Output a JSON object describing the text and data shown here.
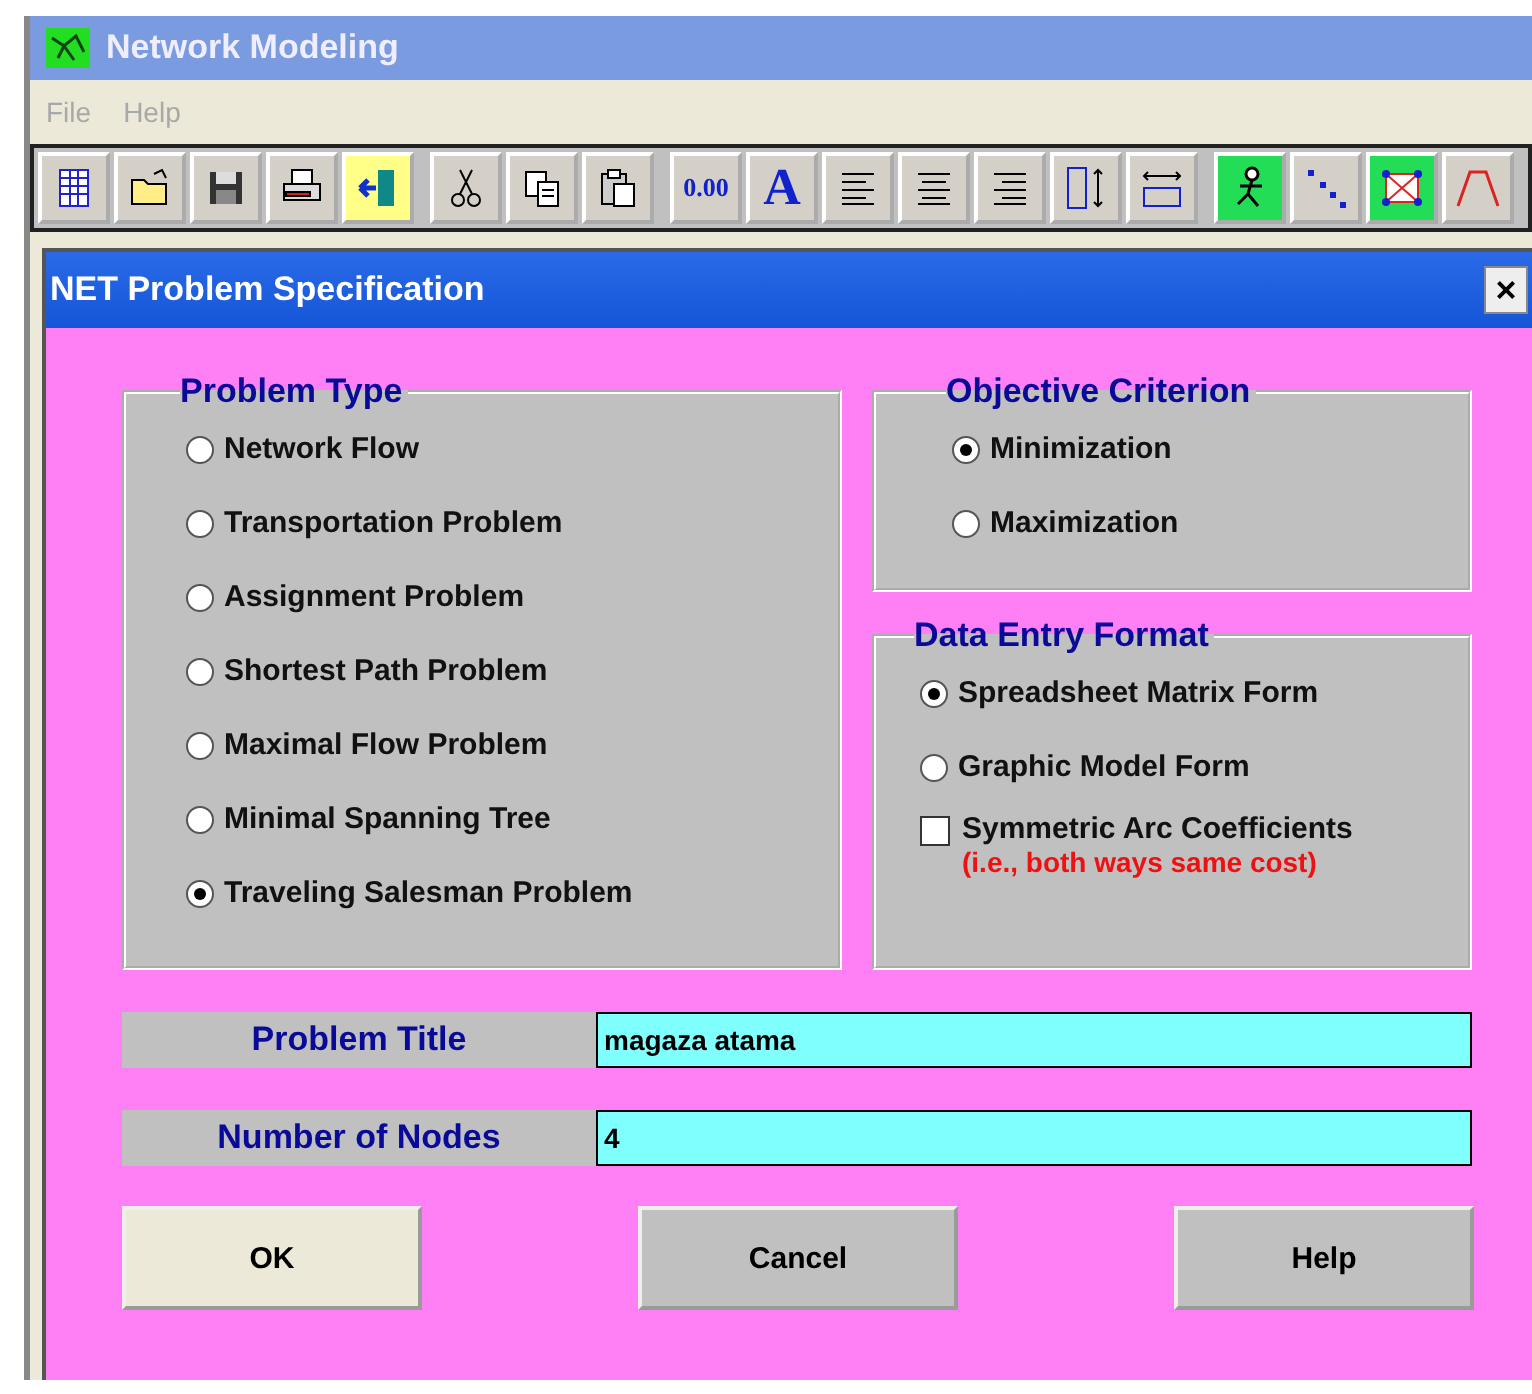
{
  "window": {
    "title": "Network Modeling"
  },
  "menu": [
    {
      "label": "File"
    },
    {
      "label": "Help"
    }
  ],
  "toolbar": [
    [
      {
        "kind": "grid"
      },
      {
        "kind": "folder"
      },
      {
        "kind": "disk"
      },
      {
        "kind": "printer"
      },
      {
        "kind": "exit"
      }
    ],
    [
      {
        "kind": "scissors"
      },
      {
        "kind": "copy"
      },
      {
        "kind": "paste"
      }
    ],
    [
      {
        "kind": "text",
        "label": "0.00"
      },
      {
        "kind": "letter",
        "label": "A"
      },
      {
        "kind": "align-left"
      },
      {
        "kind": "align-center"
      },
      {
        "kind": "align-right"
      },
      {
        "kind": "row-height"
      },
      {
        "kind": "column-width"
      }
    ],
    [
      {
        "kind": "runner"
      },
      {
        "kind": "dots"
      },
      {
        "kind": "network"
      },
      {
        "kind": "trapezoid"
      }
    ]
  ],
  "dialog": {
    "title": "NET Problem Specification",
    "close": "×",
    "problem_type": {
      "title": "Problem Type",
      "options": [
        {
          "label": "Network Flow",
          "selected": false
        },
        {
          "label": "Transportation Problem",
          "selected": false
        },
        {
          "label": "Assignment Problem",
          "selected": false
        },
        {
          "label": "Shortest Path Problem",
          "selected": false
        },
        {
          "label": "Maximal Flow Problem",
          "selected": false
        },
        {
          "label": "Minimal Spanning Tree",
          "selected": false
        },
        {
          "label": "Traveling Salesman Problem",
          "selected": true
        }
      ]
    },
    "objective": {
      "title": "Objective Criterion",
      "options": [
        {
          "label": "Minimization",
          "selected": true
        },
        {
          "label": "Maximization",
          "selected": false
        }
      ]
    },
    "data_entry": {
      "title": "Data Entry Format",
      "options": [
        {
          "label": "Spreadsheet Matrix Form",
          "selected": true
        },
        {
          "label": "Graphic Model Form",
          "selected": false
        }
      ],
      "symmetric": {
        "label": "Symmetric Arc Coefficients",
        "note": "(i.e., both ways same cost)",
        "checked": false
      }
    },
    "fields": [
      {
        "label": "Problem Title",
        "value": "magaza atama"
      },
      {
        "label": "Number of Nodes",
        "value": "4"
      }
    ],
    "buttons": [
      {
        "label": "OK",
        "default": true
      },
      {
        "label": "Cancel",
        "default": false
      },
      {
        "label": "Help",
        "default": false
      }
    ]
  }
}
